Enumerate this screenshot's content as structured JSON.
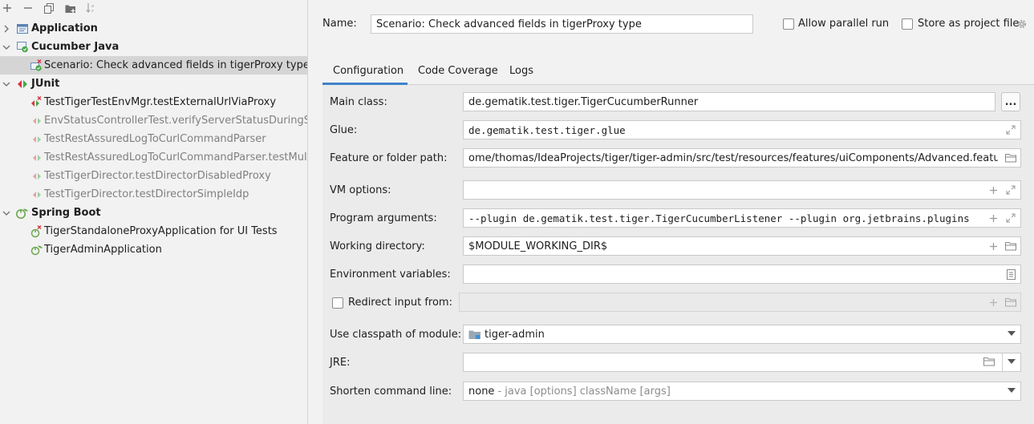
{
  "toolbar": {
    "icons": [
      "add-icon",
      "remove-icon",
      "copy-icon",
      "new-folder-icon",
      "sort-icon"
    ]
  },
  "tree": {
    "groups": {
      "application": "Application",
      "cucumber": "Cucumber Java",
      "junit": "JUnit",
      "spring": "Spring Boot"
    },
    "cucumber_items": [
      "Scenario: Check advanced fields in tigerProxy type"
    ],
    "junit_items": [
      "TestTigerTestEnvMgr.testExternalUrlViaProxy",
      "EnvStatusControllerTest.verifyServerStatusDuringStartup",
      "TestRestAssuredLogToCurlCommandParser",
      "TestRestAssuredLogToCurlCommandParser.testMultipleCommands",
      "TestTigerDirector.testDirectorDisabledProxy",
      "TestTigerDirector.testDirectorSimpleIdp"
    ],
    "spring_items": [
      "TigerStandaloneProxyApplication for UI Tests",
      "TigerAdminApplication"
    ]
  },
  "header": {
    "name_label": "Name:",
    "name_value": "Scenario: Check advanced fields in tigerProxy type",
    "allow_parallel_label": "Allow parallel run",
    "store_project_label": "Store as project file"
  },
  "tabs": [
    "Configuration",
    "Code Coverage",
    "Logs"
  ],
  "form": {
    "main_class_label": "Main class:",
    "main_class_value": "de.gematik.test.tiger.TigerCucumberRunner",
    "main_class_button": "...",
    "glue_label": "Glue:",
    "glue_value": "de.gematik.test.tiger.glue",
    "feature_label": "Feature or folder path:",
    "feature_value": "ome/thomas/IdeaProjects/tiger/tiger-admin/src/test/resources/features/uiComponents/Advanced.feature",
    "vm_label": "VM options:",
    "vm_value": "",
    "program_args_label": "Program arguments:",
    "program_args_value": "--plugin de.gematik.test.tiger.TigerCucumberListener --plugin org.jetbrains.plugins",
    "working_dir_label": "Working directory:",
    "working_dir_value": "$MODULE_WORKING_DIR$",
    "env_vars_label": "Environment variables:",
    "env_vars_value": "",
    "redirect_label": "Redirect input from:",
    "classpath_label": "Use classpath of module:",
    "classpath_value": "tiger-admin",
    "jre_label": "JRE:",
    "jre_value": "",
    "shorten_label": "Shorten command line:",
    "shorten_value": "none",
    "shorten_hint": "- java [options] className [args]"
  }
}
